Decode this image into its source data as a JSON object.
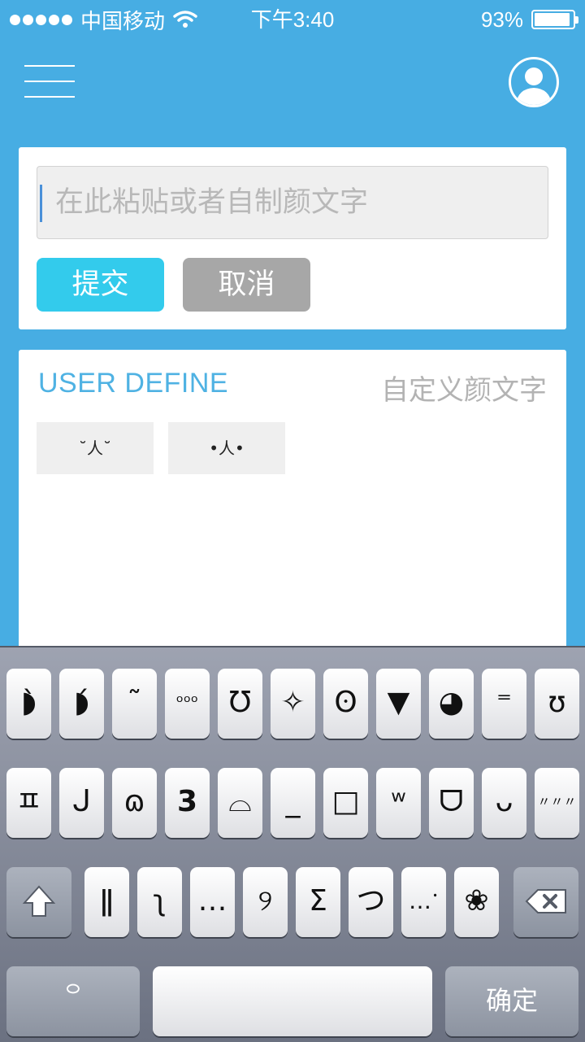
{
  "status_bar": {
    "carrier": "中国移动",
    "time": "下午3:40",
    "battery_text": "93%",
    "battery_level": 0.93
  },
  "nav": {
    "menu_icon": "menu-icon",
    "profile_icon": "user-avatar-icon"
  },
  "input_card": {
    "placeholder": "在此粘贴或者自制颜文字",
    "submit_label": "提交",
    "cancel_label": "取消"
  },
  "define_card": {
    "title": "USER DEFINE",
    "subtitle": "自定义颜文字",
    "emoticons": [
      "˘人˘",
      "•人•"
    ]
  },
  "keyboard": {
    "row1": [
      "◗̀",
      "◗́",
      "˜",
      "ᵒᵒᵒ",
      "Ʊ",
      "✧",
      "ʘ",
      "▼",
      "◕",
      "⁼",
      "ʊ"
    ],
    "row2": [
      "ㅍ",
      "ᒍ",
      "ɷ",
      "3",
      "⌓",
      "_",
      "□",
      "ʷ",
      "ᗜ",
      "ᴗ",
      "〃〃〃"
    ],
    "row3": [
      "ǁ",
      "ʅ",
      "…",
      "୨",
      "Σ",
      "つ",
      "…ॱ",
      "❀"
    ],
    "shift_icon": "shift-arrow-icon",
    "delete_icon": "backspace-icon",
    "emoji_key": "꒪",
    "space_label": "",
    "done_label": "确定"
  },
  "colors": {
    "background": "#47ade3",
    "submit_button": "#33cbec",
    "cancel_button": "#a7a7a7",
    "accent_text": "#4fb2e3"
  }
}
